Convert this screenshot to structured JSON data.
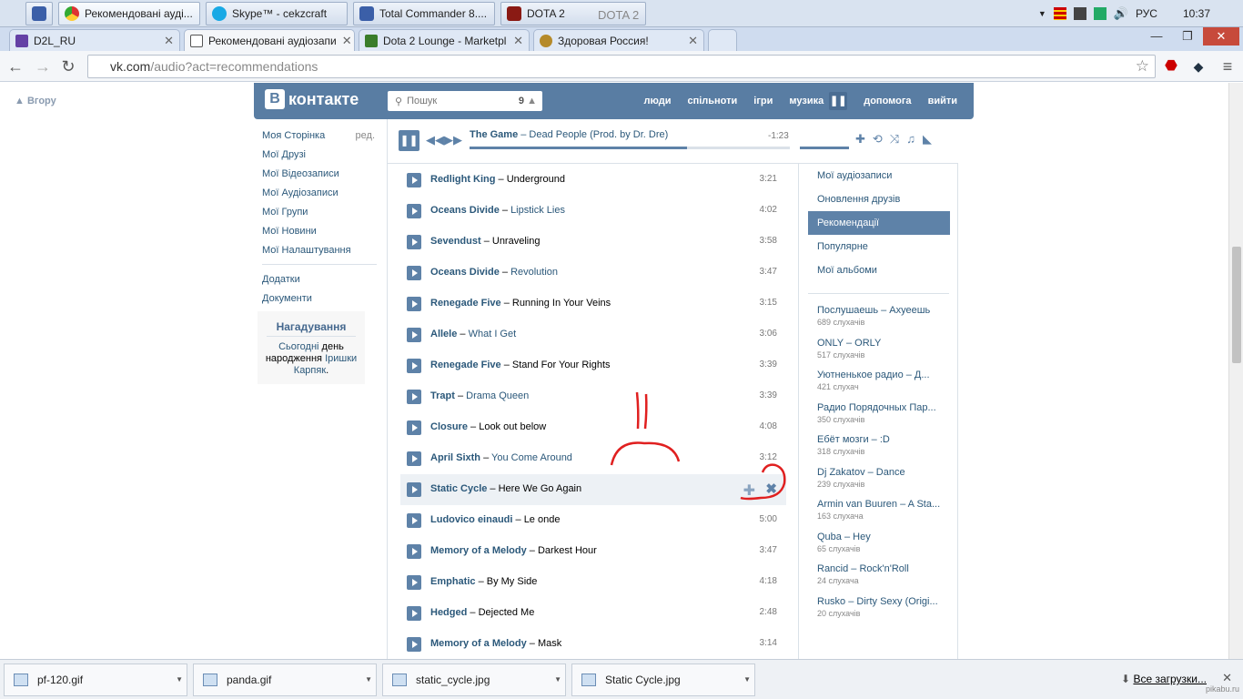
{
  "taskbar": {
    "buttons": [
      {
        "label": "",
        "icon": "floppy-icon"
      },
      {
        "label": "Рекомендовані ауді...",
        "icon": "chrome-icon"
      },
      {
        "label": "Skype™ - cekzcraft",
        "icon": "skype-icon"
      },
      {
        "label": "Total Commander 8....",
        "icon": "floppy-icon"
      },
      {
        "label": "DOTA 2",
        "icon": "dota-icon"
      }
    ],
    "ghost": "DOTA 2",
    "lang": "РУС",
    "time": "10:37"
  },
  "tabs": [
    {
      "label": "D2L_RU",
      "icon": "twitch-icon"
    },
    {
      "label": "Рекомендовані аудіозапи",
      "icon": "vk-audio-icon"
    },
    {
      "label": "Dota 2 Lounge - Marketpl",
      "icon": "lounge-icon"
    },
    {
      "label": "Здоровая Россия!",
      "icon": "bowl-icon"
    }
  ],
  "address": {
    "host": "vk.com",
    "path": "/audio?act=recommendations"
  },
  "page": {
    "up_label": "Вгору",
    "logo": "контакте",
    "logo_badge": "В",
    "search": {
      "placeholder": "Пошук",
      "count": "9"
    },
    "topnav": [
      "люди",
      "спільноти",
      "ігри",
      "музика",
      "допомога",
      "вийти"
    ],
    "left_menu": [
      "Моя Сторінка",
      "Мої Друзі",
      "Мої Відеозаписи",
      "Мої Аудіозаписи",
      "Мої Групи",
      "Мої Новини",
      "Мої Налаштування"
    ],
    "edit_label": "ред.",
    "left_menu2": [
      "Додатки",
      "Документи"
    ],
    "reminder": {
      "title": "Нагадування",
      "text1": "Сьогодні",
      "text2": "день народження",
      "link": "Іришки Карпяк",
      "dot": "."
    }
  },
  "player": {
    "artist": "The Game",
    "title": "Dead People (Prod. by Dr. Dre)",
    "time": "-1:23",
    "progress": 0.68
  },
  "tracks": [
    {
      "artist": "Redlight King",
      "title": "Underground",
      "dur": "3:21"
    },
    {
      "artist": "Oceans Divide",
      "title": "Lipstick Lies",
      "dur": "4:02"
    },
    {
      "artist": "Sevendust",
      "title": "Unraveling",
      "dur": "3:58"
    },
    {
      "artist": "Oceans Divide",
      "title": "Revolution",
      "dur": "3:47"
    },
    {
      "artist": "Renegade Five",
      "title": "Running In Your Veins",
      "dur": "3:15"
    },
    {
      "artist": "Allele",
      "title": "What I Get",
      "dur": "3:06"
    },
    {
      "artist": "Renegade Five",
      "title": "Stand For Your Rights",
      "dur": "3:39"
    },
    {
      "artist": "Trapt",
      "title": "Drama Queen",
      "dur": "3:39"
    },
    {
      "artist": "Closure",
      "title": "Look out below",
      "dur": "4:08"
    },
    {
      "artist": "April Sixth",
      "title": "You Come Around",
      "dur": "3:12"
    },
    {
      "artist": "Static Cycle",
      "title": "Here We Go Again",
      "dur": ""
    },
    {
      "artist": "Ludovico einaudi",
      "title": "Le onde",
      "dur": "5:00"
    },
    {
      "artist": "Memory of a Melody",
      "title": "Darkest Hour",
      "dur": "3:47"
    },
    {
      "artist": "Emphatic",
      "title": "By My Side",
      "dur": "4:18"
    },
    {
      "artist": "Hedged",
      "title": "Dejected Me",
      "dur": "2:48"
    },
    {
      "artist": "Memory of a Melody",
      "title": "Mask",
      "dur": "3:14"
    }
  ],
  "sep": " – ",
  "right_menu": [
    "Мої аудіозаписи",
    "Оновлення друзів",
    "Рекомендації",
    "Популярне",
    "Мої альбоми"
  ],
  "right_selected": 2,
  "playlists": [
    {
      "name": "Послушаешь – Ахуеешь",
      "count": "689 слухачів"
    },
    {
      "name": "ONLY – ORLY",
      "count": "517 слухачів"
    },
    {
      "name": "Уютненькое радио – Д...",
      "count": "421 слухач"
    },
    {
      "name": "Радио Порядочных Пар...",
      "count": "350 слухачів"
    },
    {
      "name": "Ебёт мозги – :D",
      "count": "318 слухачів"
    },
    {
      "name": "Dj Zakatov – Dance",
      "count": "239 слухачів"
    },
    {
      "name": "Armin van Buuren – A Sta...",
      "count": "163 слухача"
    },
    {
      "name": "Quba – Hey",
      "count": "65 слухачів"
    },
    {
      "name": "Rancid – Rock'n'Roll",
      "count": "24 слухача"
    },
    {
      "name": "Rusko – Dirty Sexy (Origi...",
      "count": "20 слухачів"
    }
  ],
  "downloads": [
    "pf-120.gif",
    "panda.gif",
    "static_cycle.jpg",
    "Static Cycle.jpg"
  ],
  "downloads_all": "Все загрузки...",
  "watermark": "pikabu.ru"
}
